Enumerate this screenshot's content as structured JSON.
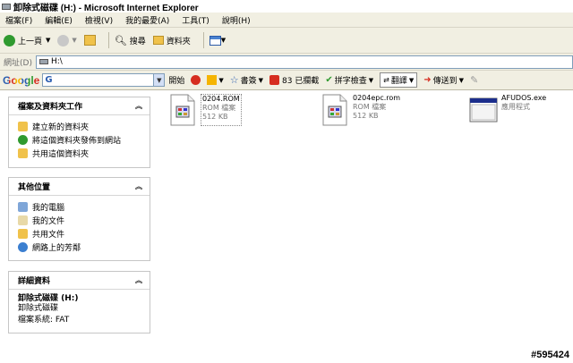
{
  "window": {
    "title": "卸除式磁碟 (H:) - Microsoft Internet Explorer"
  },
  "menu": [
    "檔案(F)",
    "編輯(E)",
    "檢視(V)",
    "我的最愛(A)",
    "工具(T)",
    "說明(H)"
  ],
  "toolbar": {
    "back": "上一頁",
    "search": "搜尋",
    "folders": "資料夾"
  },
  "address": {
    "label": "網址(D)",
    "value": "H:\\"
  },
  "google": {
    "logo": "Google",
    "search_prefix": "G",
    "go": "開始",
    "bookmarks": "書簽",
    "blocked": "83 已攔截",
    "spellcheck": "拼字檢查",
    "translate": "翻譯",
    "send_to": "傳送到"
  },
  "sidebar": {
    "tasks": {
      "title": "檔案及資料夾工作",
      "items": [
        "建立新的資料夾",
        "將這個資料夾發佈到網站",
        "共用這個資料夾"
      ]
    },
    "places": {
      "title": "其他位置",
      "items": [
        "我的電腦",
        "我的文件",
        "共用文件",
        "網路上的芳鄰"
      ]
    },
    "details": {
      "title": "詳細資料",
      "name": "卸除式磁碟 (H:)",
      "type": "卸除式磁碟",
      "fs": "檔案系統: FAT"
    }
  },
  "files": [
    {
      "name": "0204.ROM",
      "type": "ROM 檔案",
      "size": "512 KB"
    },
    {
      "name": "0204epc.rom",
      "type": "ROM 檔案",
      "size": "512 KB"
    },
    {
      "name": "AFUDOS.exe",
      "type": "應用程式",
      "size": ""
    }
  ],
  "watermark": "#595424",
  "colors": {
    "chrome": "#f1efe2",
    "accent": "#316ac5"
  }
}
